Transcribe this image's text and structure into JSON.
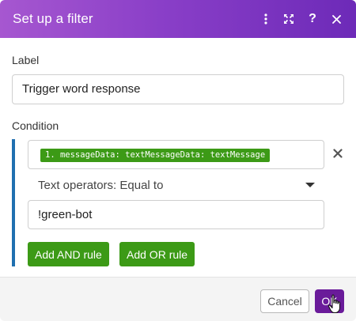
{
  "dialog": {
    "title": "Set up a filter",
    "header_icons": [
      "more-vertical-icon",
      "expand-icon",
      "help-icon",
      "close-icon"
    ],
    "help_glyph": "?",
    "accent_color": "#8a3fc8"
  },
  "form": {
    "label_caption": "Label",
    "label_value": "Trigger word response",
    "condition_caption": "Condition"
  },
  "condition": {
    "field_pill": "1. messageData: textMessageData: textMessage",
    "operator": "Text operators: Equal to",
    "value": "!green-bot",
    "add_and_label": "Add AND rule",
    "add_or_label": "Add OR rule",
    "pill_color": "#3c9a16",
    "rule_bar_color": "#1f6fb0"
  },
  "footer": {
    "cancel_label": "Cancel",
    "ok_label": "OK",
    "ok_color": "#6a1b9a"
  }
}
